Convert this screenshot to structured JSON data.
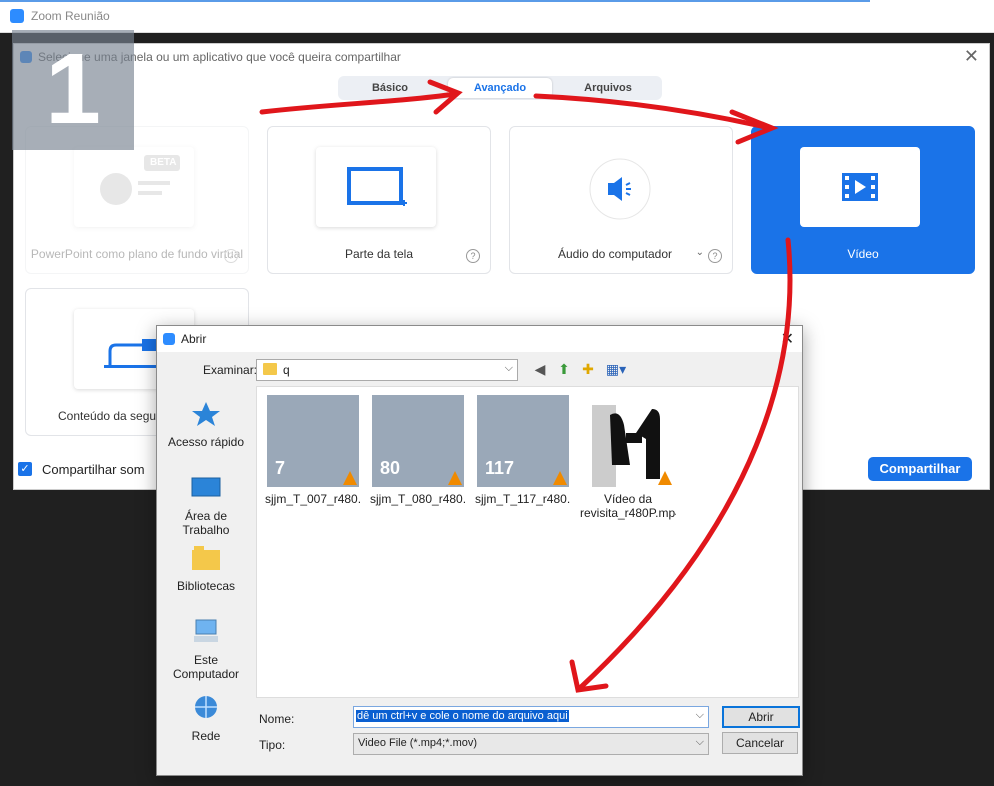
{
  "outer": {
    "title": "Zoom Reunião"
  },
  "zoom": {
    "header": "Selecione uma janela ou um aplicativo que você queira compartilhar",
    "close": "✕",
    "tabs": [
      {
        "label": "Básico",
        "active": false
      },
      {
        "label": "Avançado",
        "active": true
      },
      {
        "label": "Arquivos",
        "active": false
      }
    ],
    "overlay_number": "1",
    "cards": {
      "powerpoint": {
        "label": "PowerPoint como plano de fundo virtual",
        "badge": "BETA"
      },
      "portion": {
        "label": "Parte da tela"
      },
      "audio": {
        "label": "Áudio do computador"
      },
      "video": {
        "label": "Vídeo"
      },
      "second_camera": {
        "label": "Conteúdo da segunda câmera"
      }
    },
    "share_sound": "Compartilhar som",
    "share_button": "Compartilhar",
    "accent_color": "#1a73e8"
  },
  "open_dialog": {
    "title": "Abrir",
    "close": "✕",
    "examinar_label": "Examinar:",
    "path": "q",
    "places": [
      {
        "label": "Acesso rápido",
        "icon": "star-icon"
      },
      {
        "label": "Área de Trabalho",
        "icon": "desktop-icon"
      },
      {
        "label": "Bibliotecas",
        "icon": "libraries-icon"
      },
      {
        "label": "Este Computador",
        "icon": "computer-icon"
      },
      {
        "label": "Rede",
        "icon": "network-icon"
      }
    ],
    "files": [
      {
        "name": "sjjm_T_007_r480...",
        "number": "7"
      },
      {
        "name": "sjjm_T_080_r480...",
        "number": "80"
      },
      {
        "name": "sjjm_T_117_r480...",
        "number": "117"
      },
      {
        "name": "Vídeo da revisita_r480P.mp4",
        "number": ""
      }
    ],
    "nome_label": "Nome:",
    "nome_value": "dê um ctrl+v e cole o nome do arquivo aqui",
    "tipo_label": "Tipo:",
    "tipo_value": "Video File (*.mp4;*.mov)",
    "open_button": "Abrir",
    "cancel_button": "Cancelar"
  },
  "annotation_color": "#e0161b"
}
